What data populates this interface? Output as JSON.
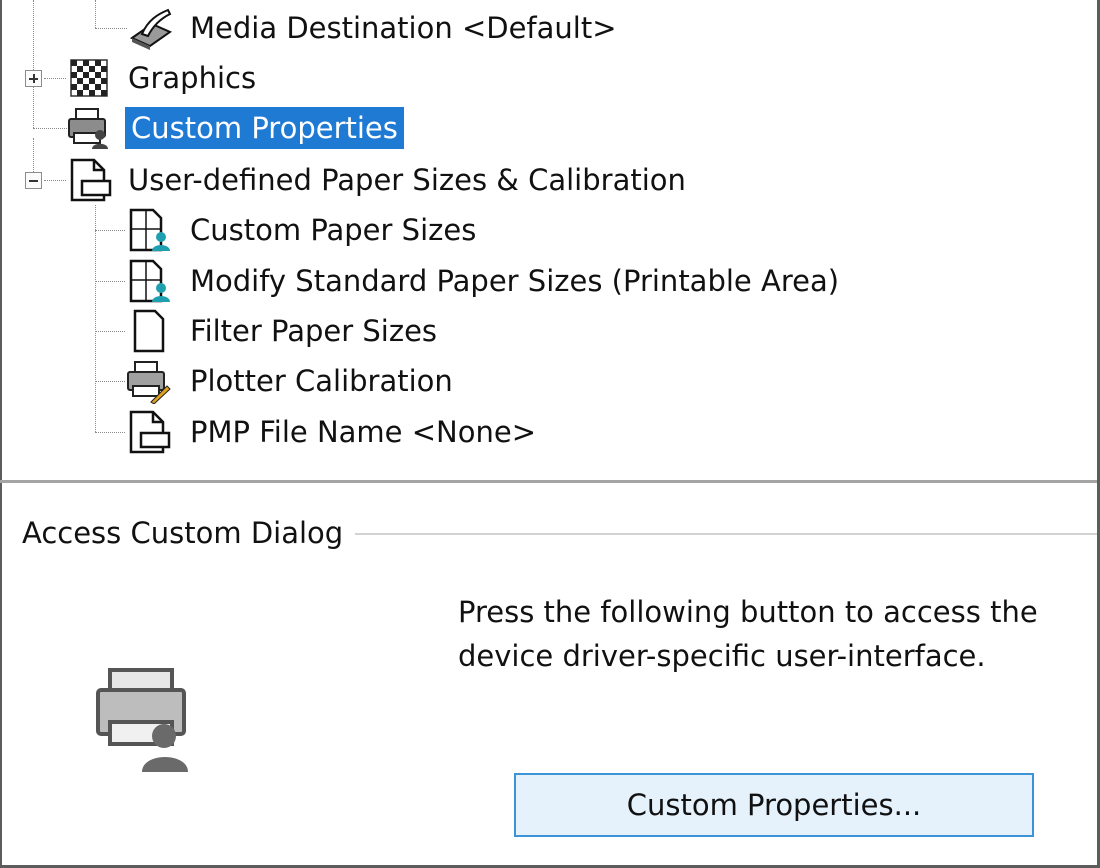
{
  "tree": {
    "items": [
      {
        "label": "Media Destination <Default>",
        "icon": "media-destination-icon"
      },
      {
        "label": "Graphics",
        "icon": "graphics-icon",
        "expander": "plus"
      },
      {
        "label": "Custom Properties",
        "icon": "printer-user-icon",
        "selected": true
      },
      {
        "label": "User-defined Paper Sizes & Calibration",
        "icon": "paper-sizes-icon",
        "expander": "minus"
      },
      {
        "label": "Custom Paper Sizes",
        "icon": "custom-paper-sizes-icon"
      },
      {
        "label": "Modify Standard Paper Sizes (Printable Area)",
        "icon": "modify-paper-sizes-icon"
      },
      {
        "label": "Filter Paper Sizes",
        "icon": "blank-page-icon"
      },
      {
        "label": "Plotter Calibration",
        "icon": "plotter-calibration-icon"
      },
      {
        "label": "PMP File Name <None>",
        "icon": "pmp-file-icon"
      }
    ]
  },
  "group": {
    "legend": "Access Custom Dialog",
    "description": "Press the following button to access the device driver-specific user-interface.",
    "icon": "printer-user-icon",
    "button_label": "Custom Properties..."
  },
  "colors": {
    "selection": "#1f7ad3",
    "button_bg": "#e5f1fb",
    "button_border": "#3c94d7"
  }
}
